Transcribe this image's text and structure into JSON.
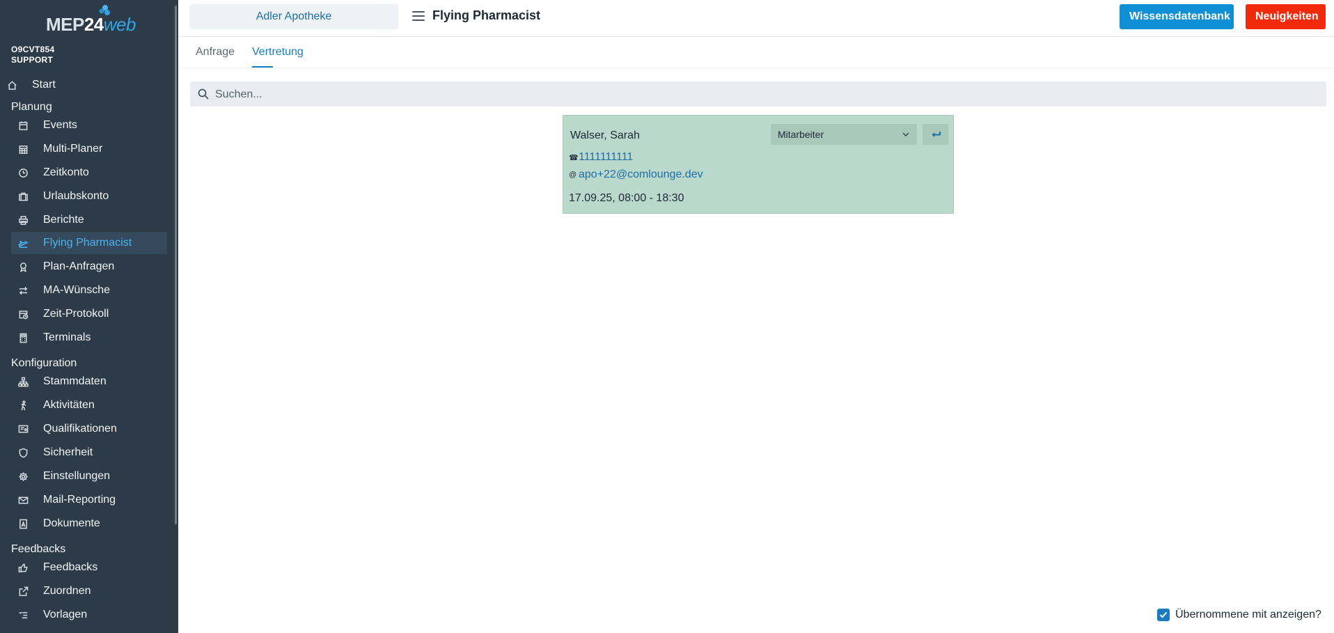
{
  "sidebar": {
    "logo": {
      "mep": "MEP",
      "num": "24",
      "web": "web"
    },
    "org_code": "O9CVT854",
    "org_role": "SUPPORT",
    "start": {
      "label": "Start",
      "icon": "home-icon"
    },
    "sections": {
      "planung": "Planung",
      "konfiguration": "Konfiguration",
      "feedbacks": "Feedbacks"
    },
    "planung_items": [
      {
        "label": "Events",
        "icon": "calendar-icon"
      },
      {
        "label": "Multi-Planer",
        "icon": "calendar-grid-icon"
      },
      {
        "label": "Zeitkonto",
        "icon": "clock-icon"
      },
      {
        "label": "Urlaubskonto",
        "icon": "suitcase-icon"
      },
      {
        "label": "Berichte",
        "icon": "printer-icon"
      },
      {
        "label": "Flying Pharmacist",
        "icon": "plane-icon"
      },
      {
        "label": "Plan-Anfragen",
        "icon": "award-icon"
      },
      {
        "label": "MA-Wünsche",
        "icon": "swap-icon"
      },
      {
        "label": "Zeit-Protokoll",
        "icon": "calendar-clock-icon"
      },
      {
        "label": "Terminals",
        "icon": "calculator-icon"
      }
    ],
    "konfiguration_items": [
      {
        "label": "Stammdaten",
        "icon": "sitemap-icon"
      },
      {
        "label": "Aktivitäten",
        "icon": "walking-icon"
      },
      {
        "label": "Qualifikationen",
        "icon": "certificate-icon"
      },
      {
        "label": "Sicherheit",
        "icon": "shield-icon"
      },
      {
        "label": "Einstellungen",
        "icon": "gear-icon"
      },
      {
        "label": "Mail-Reporting",
        "icon": "mail-icon"
      },
      {
        "label": "Dokumente",
        "icon": "document-icon"
      }
    ],
    "feedbacks_items": [
      {
        "label": "Feedbacks",
        "icon": "thumbs-up-icon"
      },
      {
        "label": "Zuordnen",
        "icon": "share-icon"
      },
      {
        "label": "Vorlagen",
        "icon": "list-icon"
      }
    ],
    "active_item": "Flying Pharmacist"
  },
  "header": {
    "pharmacy": "Adler Apotheke",
    "title": "Flying Pharmacist",
    "btn_wissen": "Wissensdatenbank",
    "btn_neu": "Neuigkeiten"
  },
  "tabs": [
    {
      "label": "Anfrage",
      "active": false
    },
    {
      "label": "Vertretung",
      "active": true
    }
  ],
  "search": {
    "placeholder": "Suchen...",
    "value": ""
  },
  "card": {
    "name": "Walser, Sarah",
    "role": "Mitarbeiter",
    "phone": "1111111111",
    "phone_glyph": "☎",
    "email": "apo+22@comlounge.dev",
    "email_glyph": "@",
    "time": "17.09.25, 08:00 - 18:30",
    "background": "#bad8cb"
  },
  "footer": {
    "show_taken_label": "Übernommene mit anzeigen?",
    "checked": true
  },
  "colors": {
    "sidebar_bg": "#2d3b48",
    "accent": "#1a7cbf",
    "active_nav": "#4db3ee",
    "btn_wissen": "#0f8fd6",
    "btn_neu": "#f22a0c"
  }
}
